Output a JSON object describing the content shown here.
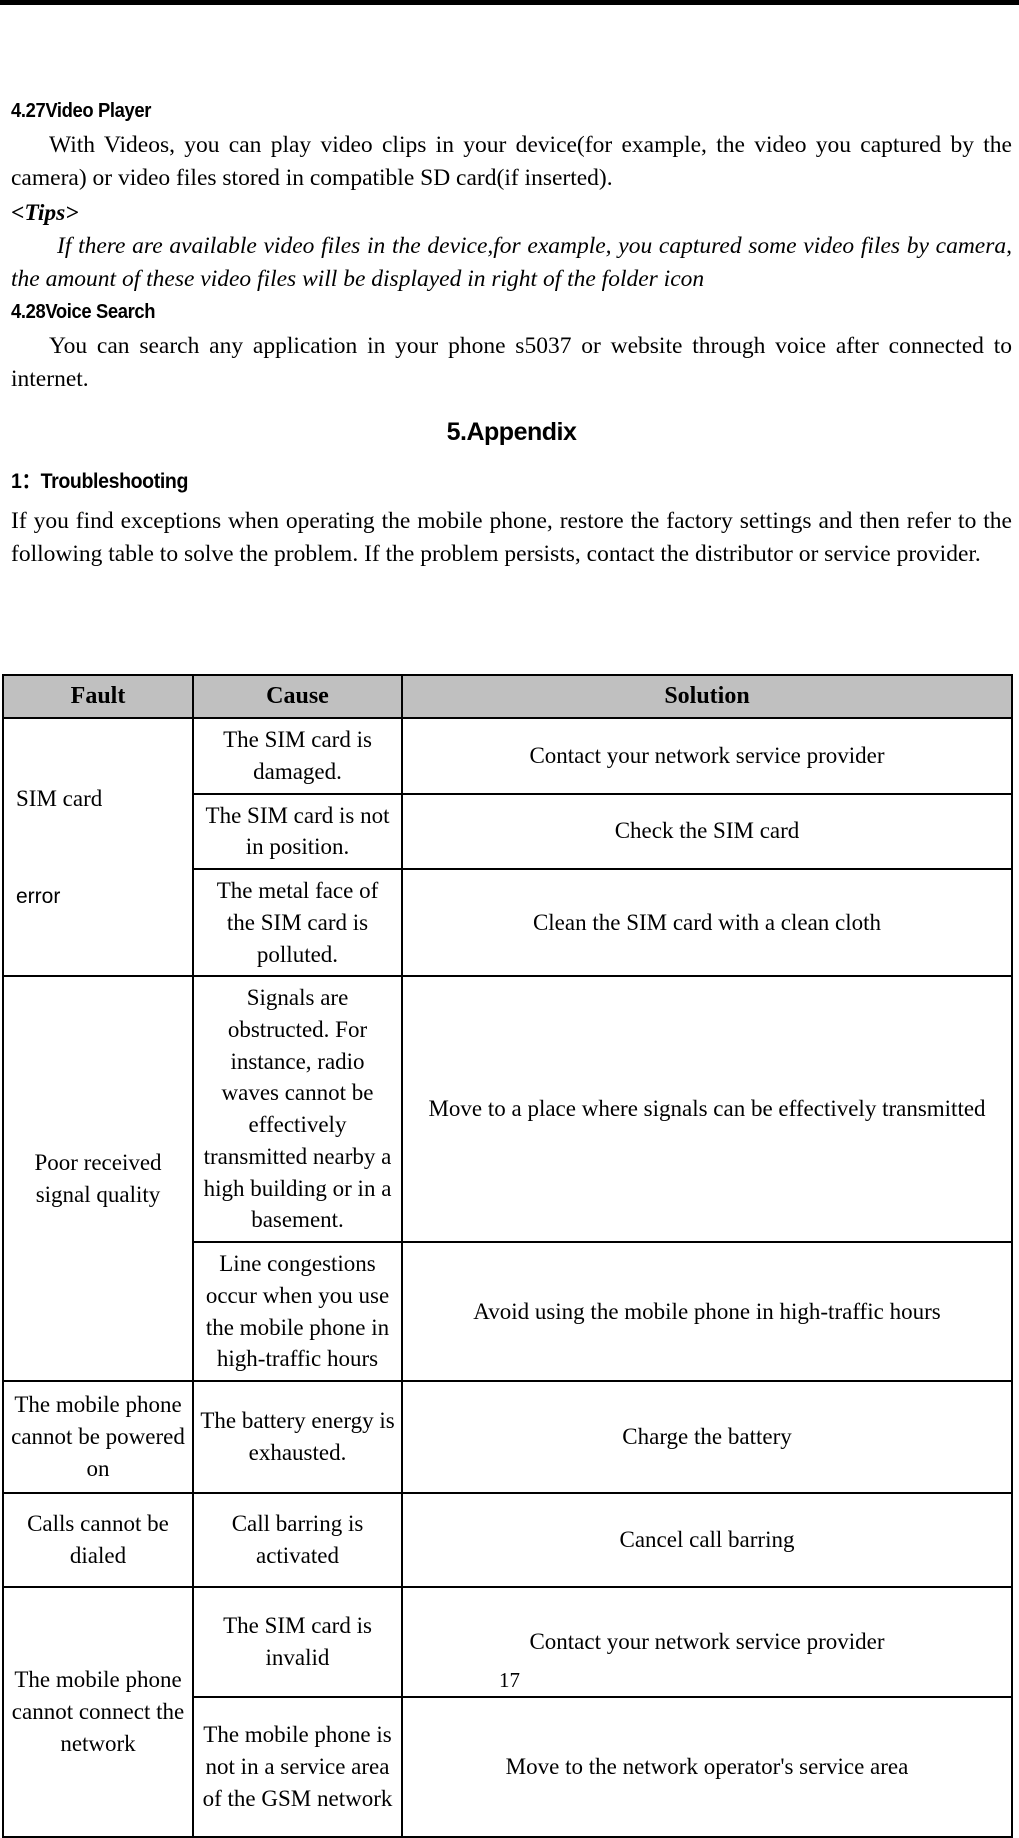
{
  "page": {
    "number": "17",
    "header_rule": true
  },
  "sections": [
    {
      "heading": "4.27Video Player",
      "paragraphs": [
        "With Videos, you can play video clips in your device(for example, the video you captured by the camera) or video files stored in compatible SD card(if inserted)."
      ],
      "tips_label": "<Tips>",
      "tips_text": "If there are available video files in the device,for example, you captured some video files by camera, the amount of these video files will be displayed in right of the folder icon"
    },
    {
      "heading": "4.28Voice Search",
      "paragraphs": [
        "You can search any application in your phone s5037   or website through voice after connected to internet."
      ]
    }
  ],
  "appendix": {
    "title": "5.Appendix",
    "troubleshooting_heading": "1：Troubleshooting",
    "intro": "If you find exceptions when operating the mobile phone, restore the factory settings and then refer to the following table to solve the problem. If the problem persists, contact the distributor or service provider.",
    "table": {
      "header_background": "#c0c0c0",
      "columns": [
        "Fault",
        "Cause",
        "Solution"
      ],
      "rows": [
        {
          "fault_line1": "SIM card",
          "fault_line2": "error",
          "entries": [
            {
              "cause": "The SIM card is damaged.",
              "solution": "Contact your network service provider"
            },
            {
              "cause": "The SIM card is not in position.",
              "solution": "Check the SIM card"
            },
            {
              "cause": "The metal face of the SIM card is polluted.",
              "solution": "Clean the SIM card with a clean cloth"
            }
          ]
        },
        {
          "fault_line1": "Poor received signal quality",
          "entries": [
            {
              "cause": "Signals are obstructed. For instance, radio waves cannot be effectively transmitted nearby a high building or in a basement.",
              "solution": "Move to a place where signals can be effectively transmitted"
            },
            {
              "cause": "Line congestions occur when you use the mobile phone in high-traffic hours",
              "solution": "Avoid using the mobile phone in high-traffic hours"
            }
          ]
        },
        {
          "fault_line1": "The mobile phone cannot be powered on",
          "entries": [
            {
              "cause": "The battery energy is exhausted.",
              "solution": "Charge the battery"
            }
          ]
        },
        {
          "fault_line1": "Calls cannot be dialed",
          "entries": [
            {
              "cause": "Call barring is activated",
              "solution": "Cancel call barring"
            }
          ]
        },
        {
          "fault_line1": "The mobile phone cannot connect the network",
          "entries": [
            {
              "cause": "The SIM card is invalid",
              "solution": "Contact your network service provider"
            },
            {
              "cause": "The mobile phone is not in a service area of the GSM network",
              "solution": "Move to the network operator's service area"
            }
          ]
        }
      ]
    }
  }
}
